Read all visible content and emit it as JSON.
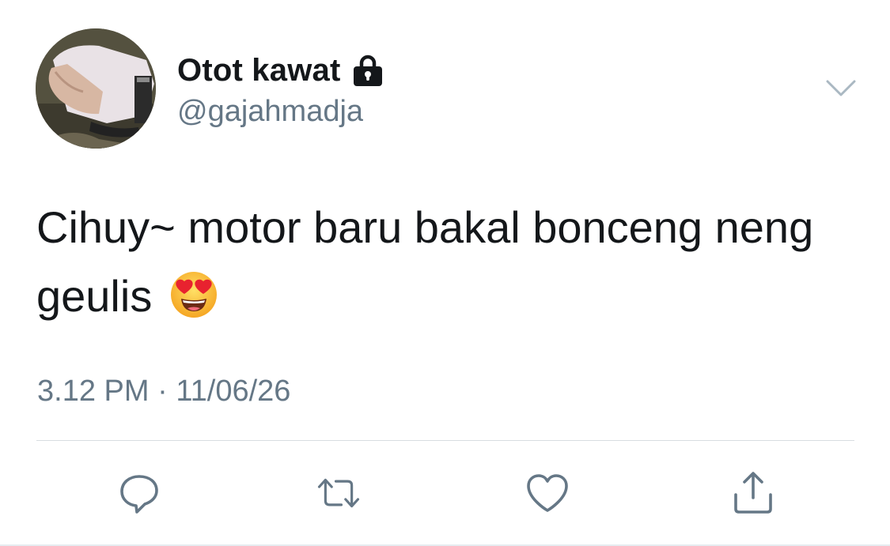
{
  "tweet": {
    "display_name": "Otot kawat",
    "handle": "@gajahmadja",
    "protected": true,
    "text": "Cihuy~ motor baru bakal bonceng neng geulis",
    "emoji": "smiling-face-with-heart-eyes",
    "time": "3.12 PM",
    "separator": "·",
    "date": "11/06/26"
  },
  "icons": {
    "lock": "lock-icon",
    "more": "chevron-down-icon",
    "reply": "reply-icon",
    "retweet": "retweet-icon",
    "like": "heart-icon",
    "share": "share-icon"
  },
  "colors": {
    "text": "#14171a",
    "secondary": "#657786",
    "icon": "#657786",
    "divider": "#d8dde1"
  }
}
